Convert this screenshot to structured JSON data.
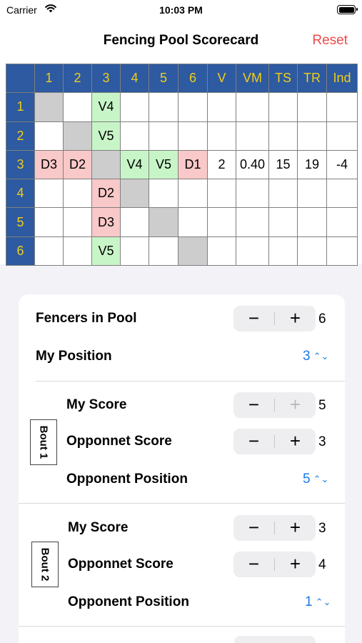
{
  "status_bar": {
    "carrier": "Carrier",
    "time": "10:03 PM"
  },
  "nav": {
    "title": "Fencing Pool Scorecard",
    "reset_label": "Reset"
  },
  "pool_table": {
    "headers": [
      "",
      "1",
      "2",
      "3",
      "4",
      "5",
      "6",
      "V",
      "VM",
      "TS",
      "TR",
      "Ind"
    ],
    "rows": [
      {
        "label": "1",
        "cells": [
          "",
          "",
          "V4",
          "",
          "",
          "",
          "",
          "",
          "",
          "",
          ""
        ],
        "types": [
          "d",
          "p",
          "w",
          "p",
          "p",
          "p",
          "p",
          "p",
          "p",
          "p",
          "p"
        ]
      },
      {
        "label": "2",
        "cells": [
          "",
          "",
          "V5",
          "",
          "",
          "",
          "",
          "",
          "",
          "",
          ""
        ],
        "types": [
          "p",
          "d",
          "w",
          "p",
          "p",
          "p",
          "p",
          "p",
          "p",
          "p",
          "p"
        ]
      },
      {
        "label": "3",
        "cells": [
          "D3",
          "D2",
          "",
          "V4",
          "V5",
          "D1",
          "2",
          "0.40",
          "15",
          "19",
          "-4"
        ],
        "types": [
          "l",
          "l",
          "d",
          "w",
          "w",
          "l",
          "p",
          "p",
          "p",
          "p",
          "p"
        ]
      },
      {
        "label": "4",
        "cells": [
          "",
          "",
          "D2",
          "",
          "",
          "",
          "",
          "",
          "",
          "",
          ""
        ],
        "types": [
          "p",
          "p",
          "l",
          "d",
          "p",
          "p",
          "p",
          "p",
          "p",
          "p",
          "p"
        ]
      },
      {
        "label": "5",
        "cells": [
          "",
          "",
          "D3",
          "",
          "",
          "",
          "",
          "",
          "",
          "",
          ""
        ],
        "types": [
          "p",
          "p",
          "l",
          "p",
          "d",
          "p",
          "p",
          "p",
          "p",
          "p",
          "p"
        ]
      },
      {
        "label": "6",
        "cells": [
          "",
          "",
          "V5",
          "",
          "",
          "",
          "",
          "",
          "",
          "",
          ""
        ],
        "types": [
          "p",
          "p",
          "w",
          "p",
          "p",
          "d",
          "p",
          "p",
          "p",
          "p",
          "p"
        ]
      }
    ],
    "colors": {
      "header_bg": "#2d5aa0",
      "header_text": "#f1cd1b",
      "win": "#c8f5c8",
      "loss": "#f9c8c8",
      "diagonal": "#cdcdcd"
    }
  },
  "settings": {
    "fencers_label": "Fencers in Pool",
    "fencers_value": "6",
    "my_position_label": "My Position",
    "my_position_value": "3"
  },
  "bouts": [
    {
      "title": "Bout 1",
      "my_score_label": "My Score",
      "my_score": "5",
      "opp_score_label": "Opponnet Score",
      "opp_score": "3",
      "opp_position_label": "Opponent Position",
      "opp_position": "5"
    },
    {
      "title": "Bout 2",
      "my_score_label": "My Score",
      "my_score": "3",
      "opp_score_label": "Opponnet Score",
      "opp_score": "4",
      "opp_position_label": "Opponent Position",
      "opp_position": "1"
    }
  ],
  "symbols": {
    "minus": "−",
    "plus": "+",
    "updown": "⌃⌄"
  },
  "icons": [
    "wifi-icon",
    "battery-icon",
    "minus-icon",
    "plus-icon",
    "up-down-chevron-icon"
  ]
}
